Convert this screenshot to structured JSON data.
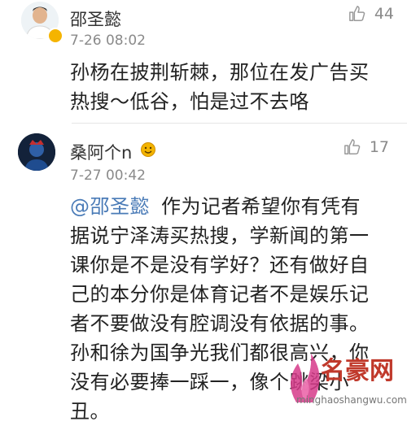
{
  "comments": [
    {
      "username": "邵圣懿",
      "time": "7-26 08:02",
      "likes": "44",
      "text_lines": [
        "孙杨在披荆斩棘，那位在发广告买",
        "热搜～低谷，怕是过不去咯"
      ]
    },
    {
      "username": "桑阿个n",
      "time": "7-27 00:42",
      "likes": "17",
      "mention": "@邵圣懿",
      "text_lines": [
        "作为记者希望你有凭有",
        "据说宁泽涛买热搜，学新闻的第一",
        "课你是不是没有学好？还有做好自",
        "己的本分你是体育记者不是娱乐记",
        "者不要做没有腔调没有依据的事。",
        "孙和徐为国争光我们都很高兴，你",
        "没有必要捧一踩一，像个跳梁小",
        "丑。"
      ]
    }
  ],
  "watermark": {
    "brand": "名豪网",
    "url": "minghaoshangwu.com"
  },
  "colors": {
    "mention": "#4a7bb7",
    "secondary_text": "#8a8a8a",
    "watermark": "#c0392b"
  }
}
